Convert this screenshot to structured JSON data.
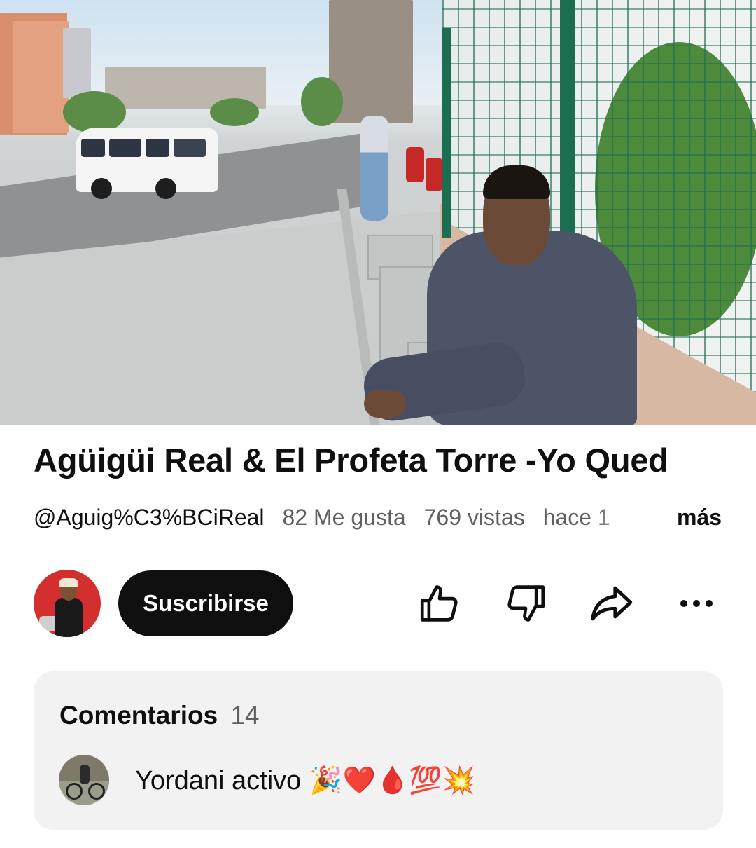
{
  "video": {
    "description_icon": "video-thumbnail"
  },
  "title": "Agüigüi Real & El Profeta Torre -Yo Qued",
  "meta": {
    "handle": "@Aguig%C3%BCiReal",
    "likes": "82 Me gusta",
    "views": "769 vistas",
    "age": "hace 1",
    "more": "más"
  },
  "actions": {
    "subscribe_label": "Suscribirse",
    "icons": [
      "thumbs-up-icon",
      "thumbs-down-icon",
      "share-icon",
      "more-options-icon"
    ]
  },
  "comments": {
    "title": "Comentarios",
    "count": "14",
    "top_comment": {
      "text": "Yordani activo",
      "emoji": "🎉❤️🩸💯💥"
    }
  },
  "colors": {
    "text": "#0f0f0f",
    "secondary": "#606060",
    "subscribe_bg": "#0f0f0f",
    "card_bg": "#f2f2f2"
  }
}
